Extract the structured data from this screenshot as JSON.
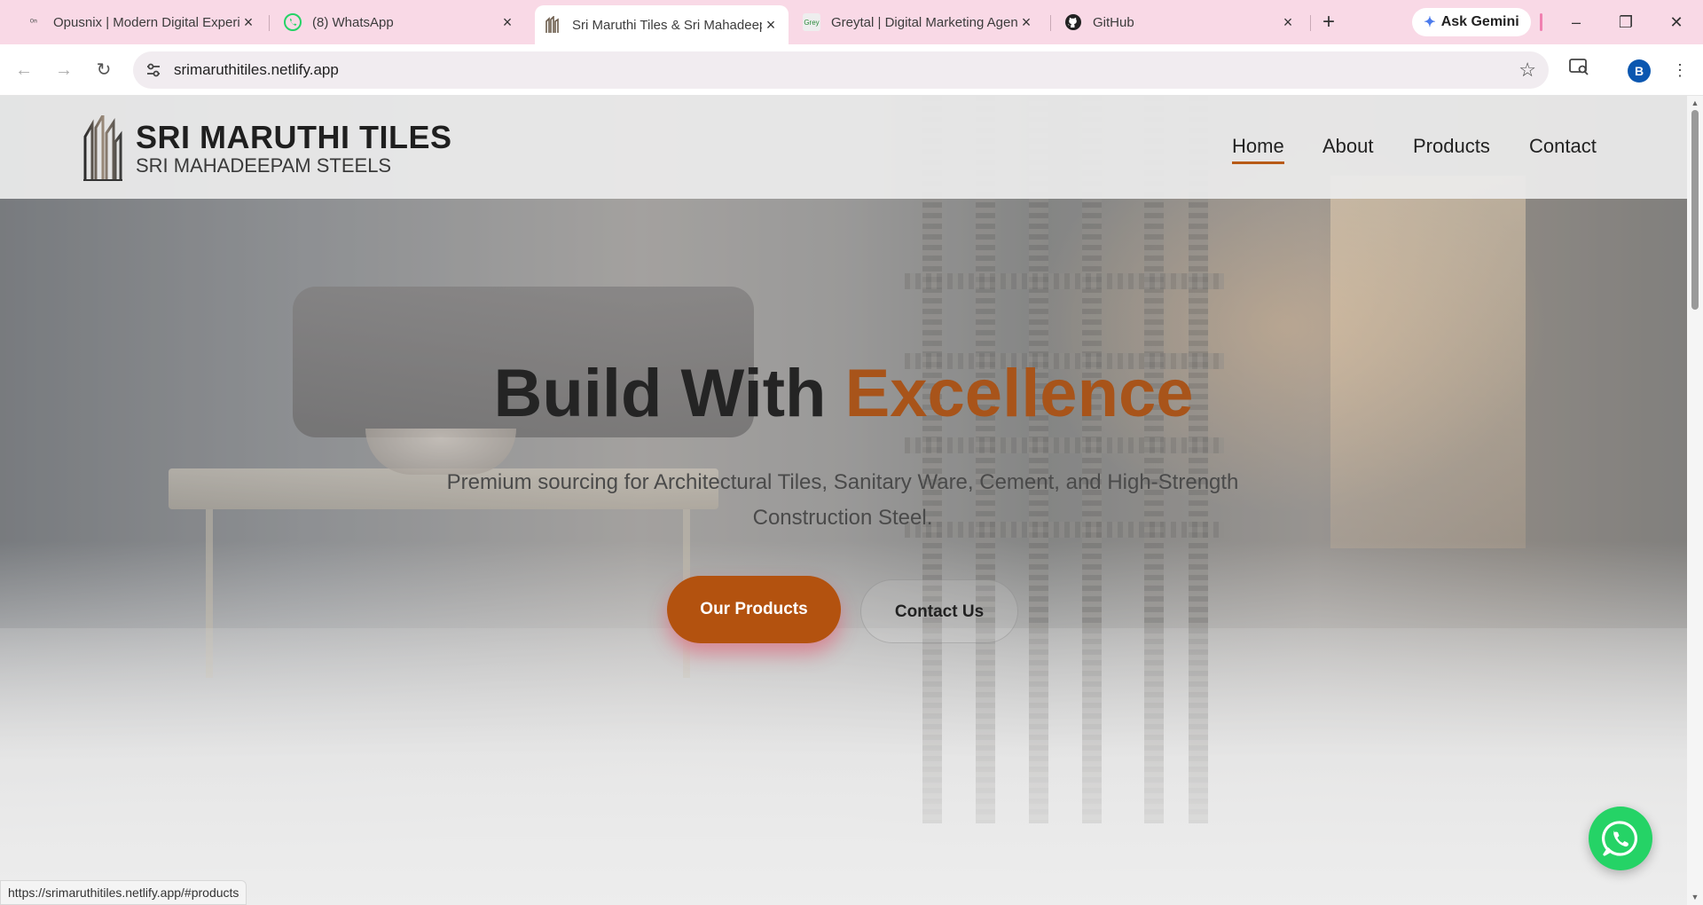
{
  "browser": {
    "tabs": [
      {
        "title": "Opusnix | Modern Digital Experiences",
        "favicon": "opusnix-icon"
      },
      {
        "title": "(8) WhatsApp",
        "favicon": "whatsapp-icon"
      },
      {
        "title": "Sri Maruthi Tiles & Sri Mahadeepam Steels",
        "favicon": "building-icon",
        "active": true
      },
      {
        "title": "Greytal | Digital Marketing Agency",
        "favicon": "greytal-icon"
      },
      {
        "title": "GitHub",
        "favicon": "github-icon"
      }
    ],
    "gemini_label": "Ask Gemini",
    "url": "srimaruthitiles.netlify.app",
    "profile_initial": "B",
    "status_url": "https://srimaruthitiles.netlify.app/#products"
  },
  "site": {
    "brand_title": "SRI MARUTHI TILES",
    "brand_subtitle": "SRI MAHADEEPAM STEELS",
    "nav": [
      "Home",
      "About",
      "Products",
      "Contact"
    ],
    "hero": {
      "title_part1": "Build With",
      "title_accent": "Excellence",
      "subtitle": "Premium sourcing for Architectural Tiles, Sanitary Ware, Cement, and High-Strength Construction Steel.",
      "primary_cta": "Our Products",
      "secondary_cta": "Contact Us"
    }
  },
  "colors": {
    "accent": "#b3520f",
    "tabstrip": "#f9d9e6",
    "whatsapp": "#25d366"
  }
}
